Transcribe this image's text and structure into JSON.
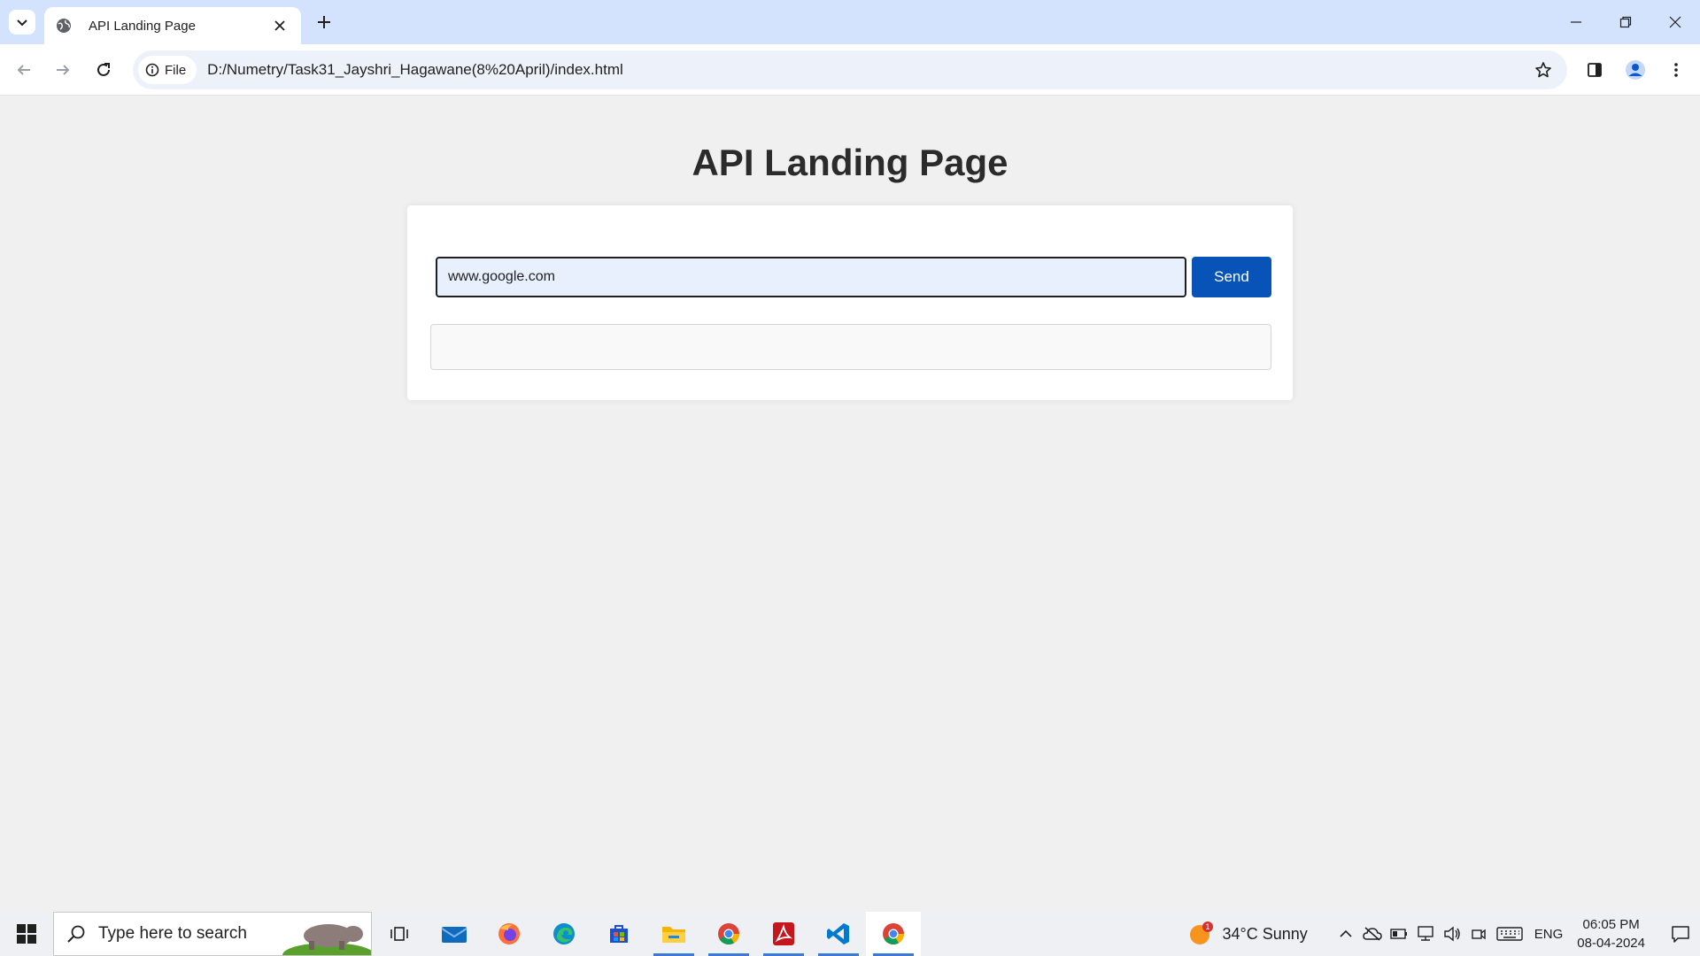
{
  "browser": {
    "tab_title": "API Landing Page",
    "new_tab_symbol": "+",
    "address_chip": "File",
    "url": "D:/Numetry/Task31_Jayshri_Hagawane(8%20April)/index.html"
  },
  "page": {
    "heading": "API Landing Page",
    "url_input_value": "www.google.com",
    "send_label": "Send",
    "response_text": ""
  },
  "taskbar": {
    "search_placeholder": "Type here to search",
    "weather": "34°C  Sunny",
    "weather_badge": "1",
    "language": "ENG",
    "time": "06:05 PM",
    "date": "08-04-2024",
    "pinned_icons": [
      "task-view-icon",
      "mail-icon",
      "firefox-icon",
      "edge-icon",
      "store-icon",
      "file-explorer-icon",
      "chrome-icon",
      "acrobat-icon",
      "vscode-icon",
      "chrome-icon"
    ]
  },
  "colors": {
    "tab_strip": "#d3e3fd",
    "send_button": "#0753b8",
    "page_background": "#f0f0f0",
    "input_background": "#e8f0fe"
  }
}
